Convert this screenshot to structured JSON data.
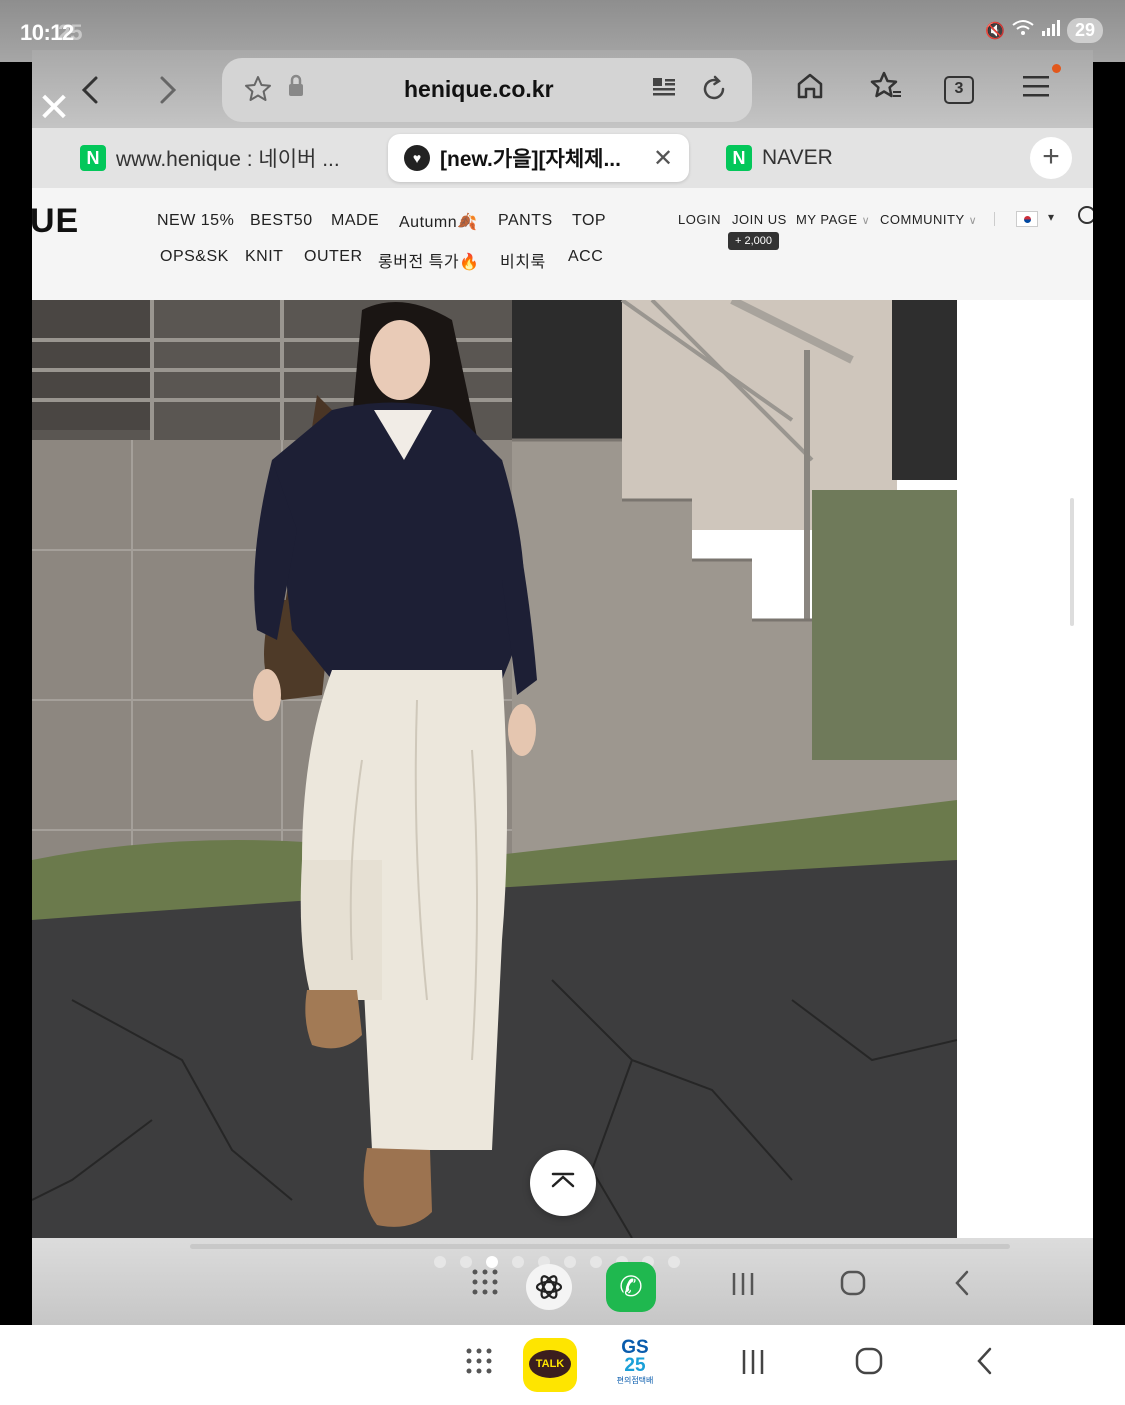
{
  "status": {
    "time": "10:12",
    "time_ghost": "25",
    "battery": "29"
  },
  "browser": {
    "url": "henique.co.kr",
    "tab_count": "3",
    "tabs": [
      {
        "label": "www.henique : 네이버 ...",
        "icon": "naver-icon"
      },
      {
        "label": "[new.가을][자체제...",
        "icon": "henique-heart-icon"
      },
      {
        "label": "NAVER",
        "icon": "naver-icon"
      }
    ],
    "naver_letter": "N",
    "new_tab_symbol": "+"
  },
  "site": {
    "logo": "UE",
    "menu_row1": [
      "NEW 15%",
      "BEST50",
      "MADE",
      "Autumn🍂",
      "PANTS",
      "TOP"
    ],
    "menu_row2": [
      "OPS&SK",
      "KNIT",
      "OUTER",
      "롱버전 특가🔥",
      "비치룩",
      "ACC"
    ],
    "util": {
      "login": "LOGIN",
      "join": "JOIN US",
      "mypage": "MY PAGE",
      "community": "COMMUNITY",
      "points": "+ 2,000",
      "chevron": "∨"
    }
  },
  "apps": {
    "kakao": "TALK",
    "gs25_line1": "GS",
    "gs25_line2": "25",
    "gs25_line3": "편의점택배"
  },
  "colors": {
    "naver_green": "#03c75a",
    "kakao_yellow": "#fee500",
    "accent_orange": "#e2581c"
  }
}
